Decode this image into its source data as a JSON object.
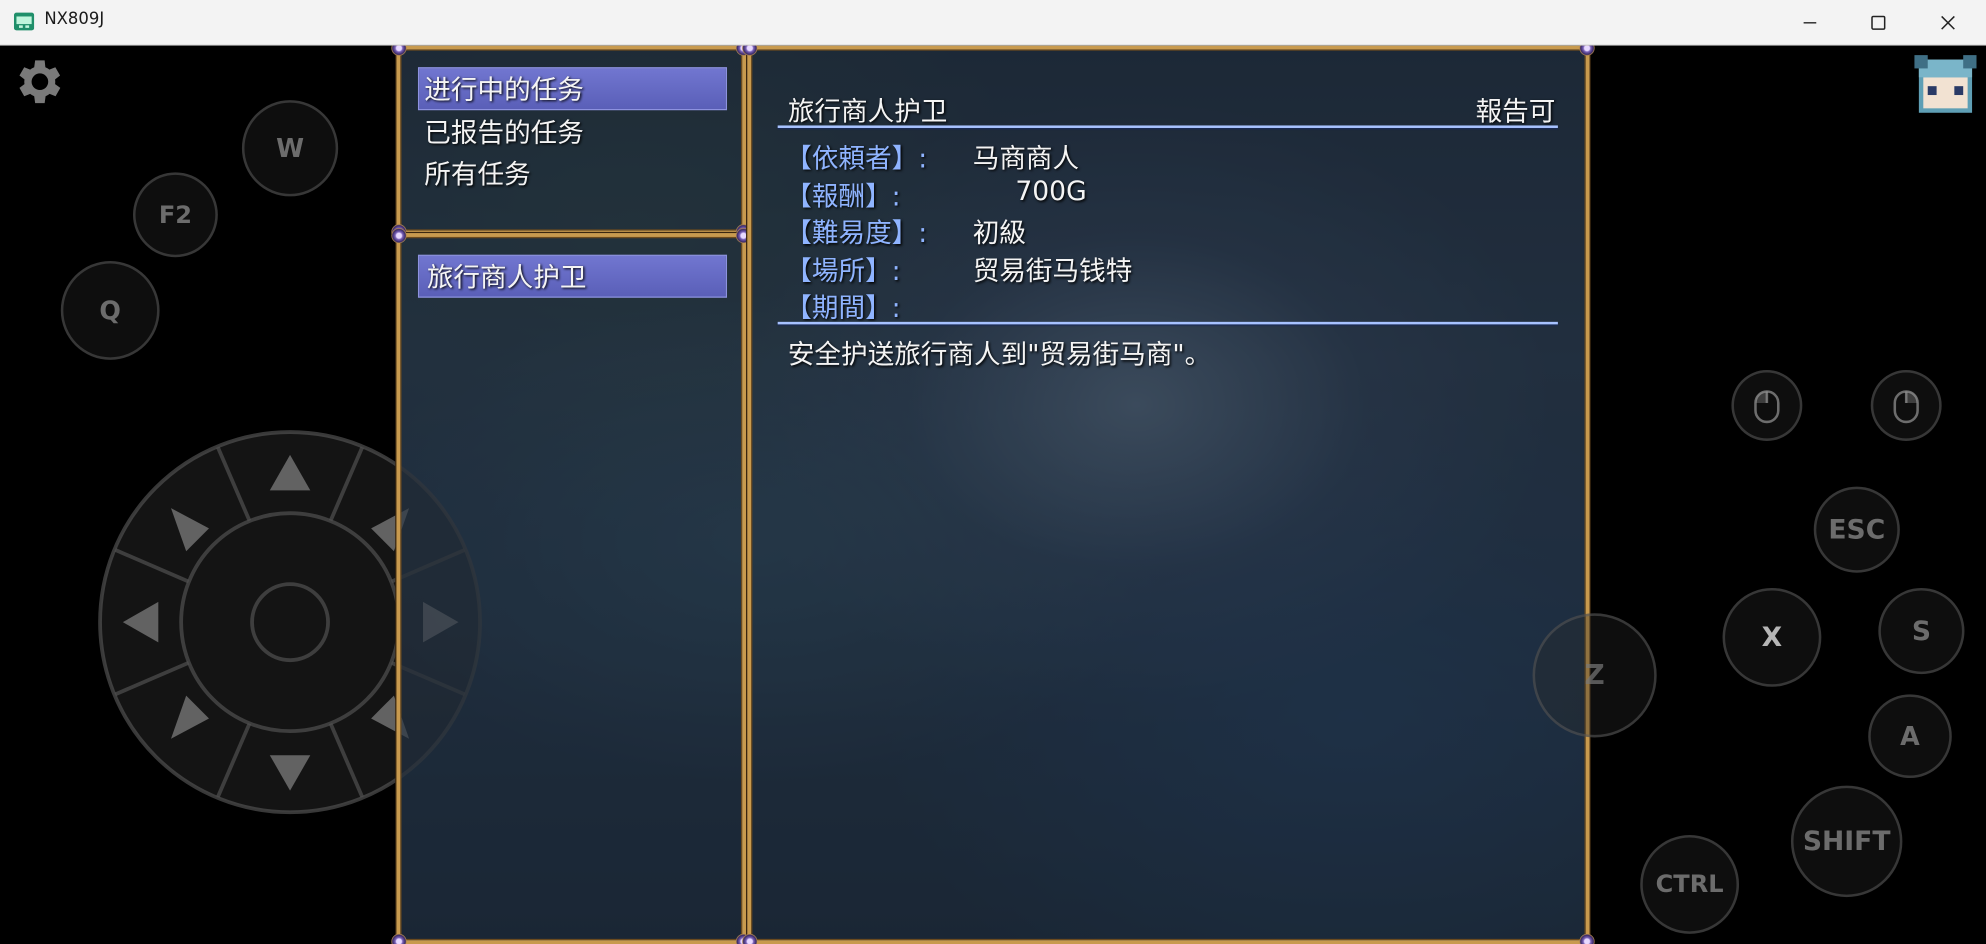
{
  "window": {
    "title": "NX809J"
  },
  "quest_categories": [
    "进行中的任务",
    "已报告的任务",
    "所有任务"
  ],
  "quest_list": [
    "旅行商人护卫"
  ],
  "detail": {
    "quest_name": "旅行商人护卫",
    "status": "報告可",
    "fields": [
      {
        "label": "【依頼者】:",
        "value": "马商商人"
      },
      {
        "label": "【報酬】:",
        "value": "700G"
      },
      {
        "label": "【難易度】:",
        "value": "初級"
      },
      {
        "label": "【場所】:",
        "value": "贸易街马钱特"
      },
      {
        "label": "【期間】:",
        "value": ""
      }
    ],
    "description": "安全护送旅行商人到\"贸易街马商\"。"
  },
  "controls": {
    "left_buttons": [
      "W",
      "F2",
      "Q"
    ],
    "right_buttons": [
      "ESC",
      "X",
      "S",
      "Z",
      "A",
      "SHIFT",
      "CTRL"
    ]
  },
  "colors": {
    "window_border": "#c89a4e",
    "selection": "#6368c4",
    "label": "#8fb4ff"
  }
}
